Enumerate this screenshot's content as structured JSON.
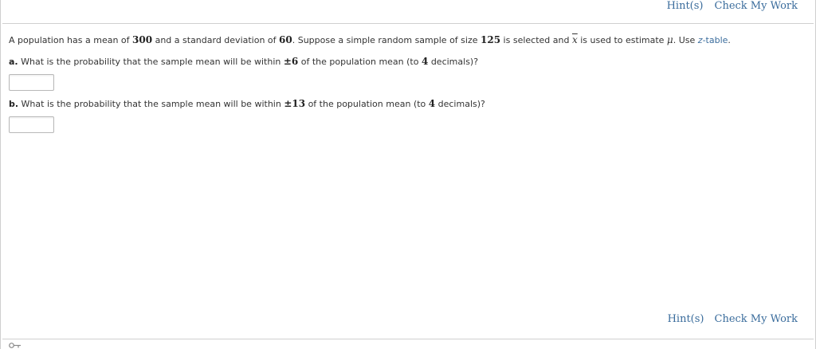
{
  "header": {
    "hint_label": "Hint(s)",
    "check_label": "Check My Work"
  },
  "question": {
    "intro": {
      "t1": "A population has a mean of ",
      "mean": "300",
      "t2": " and a standard deviation of ",
      "sd": "60",
      "t3": ". Suppose a simple random sample of size ",
      "n": "125",
      "t4": " is selected and ",
      "xbar": "x",
      "t5": " is used to estimate ",
      "mu": "μ",
      "t6": ". Use ",
      "ztable_z": "z",
      "ztable_rest": "-table",
      "t7": "."
    },
    "part_a": {
      "label": "a.",
      "t1": " What is the probability that the sample mean will be within ",
      "pm": "±6",
      "t2": " of the population mean (to ",
      "dec": "4",
      "t3": " decimals)?"
    },
    "part_b": {
      "label": "b.",
      "t1": " What is the probability that the sample mean will be within ",
      "pm": "±13",
      "t2": " of the population mean (to ",
      "dec": "4",
      "t3": " decimals)?"
    }
  },
  "answers": {
    "a": "",
    "b": ""
  },
  "footer": {
    "hint_label": "Hint(s)",
    "check_label": "Check My Work",
    "icon": "key-icon"
  }
}
